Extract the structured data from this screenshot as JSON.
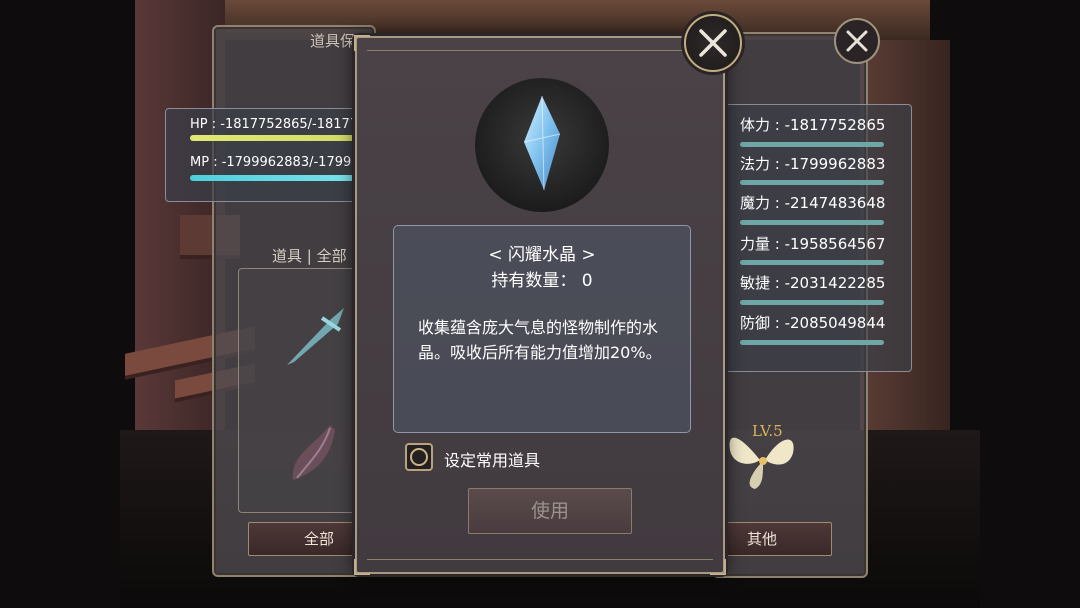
{
  "background_panel": {
    "title": "道具保管箱",
    "hp_text": "HP : -1817752865/-1817752865",
    "mp_text": "MP : -1799962883/-1799962883",
    "category_label": "道具 | 全部",
    "tab_all": "全部",
    "tab_other": "其他",
    "item_level": "LV.5"
  },
  "stats": [
    {
      "label": "体力 : -1817752865"
    },
    {
      "label": "法力 : -1799962883"
    },
    {
      "label": "魔力 : -2147483648"
    },
    {
      "label": "力量 : -1958564567"
    },
    {
      "label": "敏捷 : -2031422285"
    },
    {
      "label": "防御 : -2085049844"
    }
  ],
  "dialog": {
    "item_name": "< 闪耀水晶 >",
    "count_text": "持有数量：  0",
    "description": "收集蕴含庞大气息的怪物制作的水晶。吸收后所有能力值增加20%。",
    "checkbox_label": "设定常用道具",
    "use_button": "使用",
    "icon": "crystal-icon"
  },
  "colors": {
    "hp_bar": "#dfe872",
    "mp_bar": "#4fd0dc",
    "frame_gold": "#c1ad82",
    "crystal": "#8fd0f5"
  }
}
